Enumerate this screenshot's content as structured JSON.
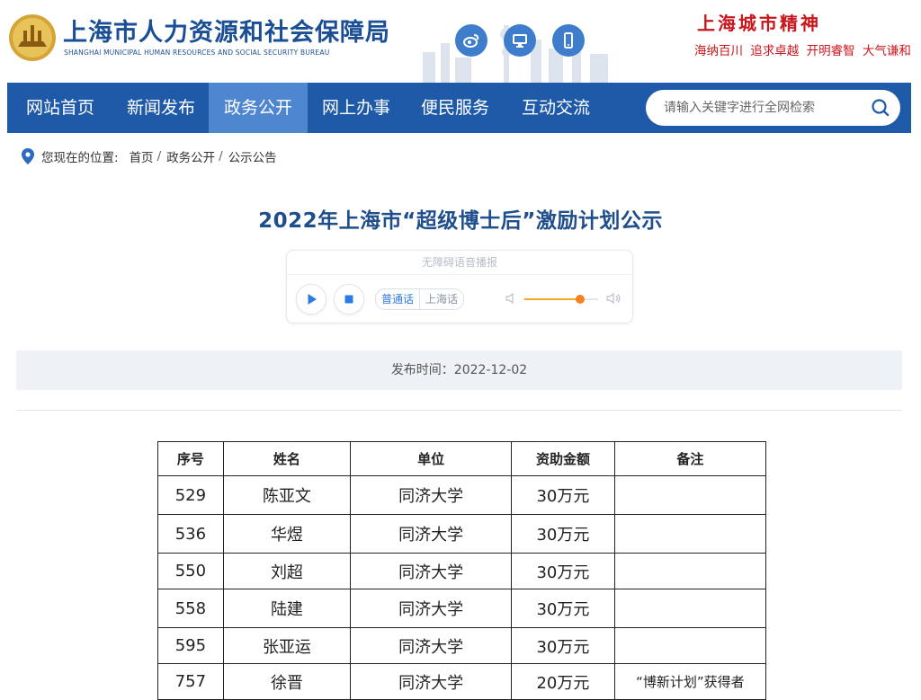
{
  "header": {
    "site_name": "上海市人力资源和社会保障局",
    "site_name_en": "SHANGHAI MUNICIPAL HUMAN RESOURCES AND SOCIAL SECURITY BUREAU",
    "social_icons": [
      "weibo-icon",
      "desktop-icon",
      "mobile-icon"
    ],
    "spirit_title": "上海城市精神",
    "spirit_text": "海纳百川 追求卓越 开明睿智 大气谦和",
    "brand_color": "#1f5aa8",
    "accent_red": "#c8161d"
  },
  "nav": {
    "items": [
      {
        "label": "网站首页"
      },
      {
        "label": "新闻发布"
      },
      {
        "label": "政务公开",
        "active": true
      },
      {
        "label": "网上办事"
      },
      {
        "label": "便民服务"
      },
      {
        "label": "互动交流"
      }
    ],
    "search_placeholder": "请输入关键字进行全网检索"
  },
  "breadcrumb": {
    "prefix": "您现在的位置:",
    "items": [
      "首页",
      "政务公开",
      "公示公告"
    ]
  },
  "article": {
    "title": "2022年上海市“超级博士后”激励计划公示",
    "publish_text": "发布时间：2022-12-02"
  },
  "player": {
    "title": "无障碍语音播报",
    "lang_active": "普通话",
    "lang_other": "上海话",
    "volume": 0.75
  },
  "table": {
    "headers": [
      "序号",
      "姓名",
      "单位",
      "资助金额",
      "备注"
    ],
    "rows": [
      [
        "529",
        "陈亚文",
        "同济大学",
        "30万元",
        ""
      ],
      [
        "536",
        "华煜",
        "同济大学",
        "30万元",
        ""
      ],
      [
        "550",
        "刘超",
        "同济大学",
        "30万元",
        ""
      ],
      [
        "558",
        "陆建",
        "同济大学",
        "30万元",
        ""
      ],
      [
        "595",
        "张亚运",
        "同济大学",
        "30万元",
        ""
      ],
      [
        "757",
        "徐晋",
        "同济大学",
        "20万元",
        "“博新计划”获得者"
      ]
    ]
  }
}
